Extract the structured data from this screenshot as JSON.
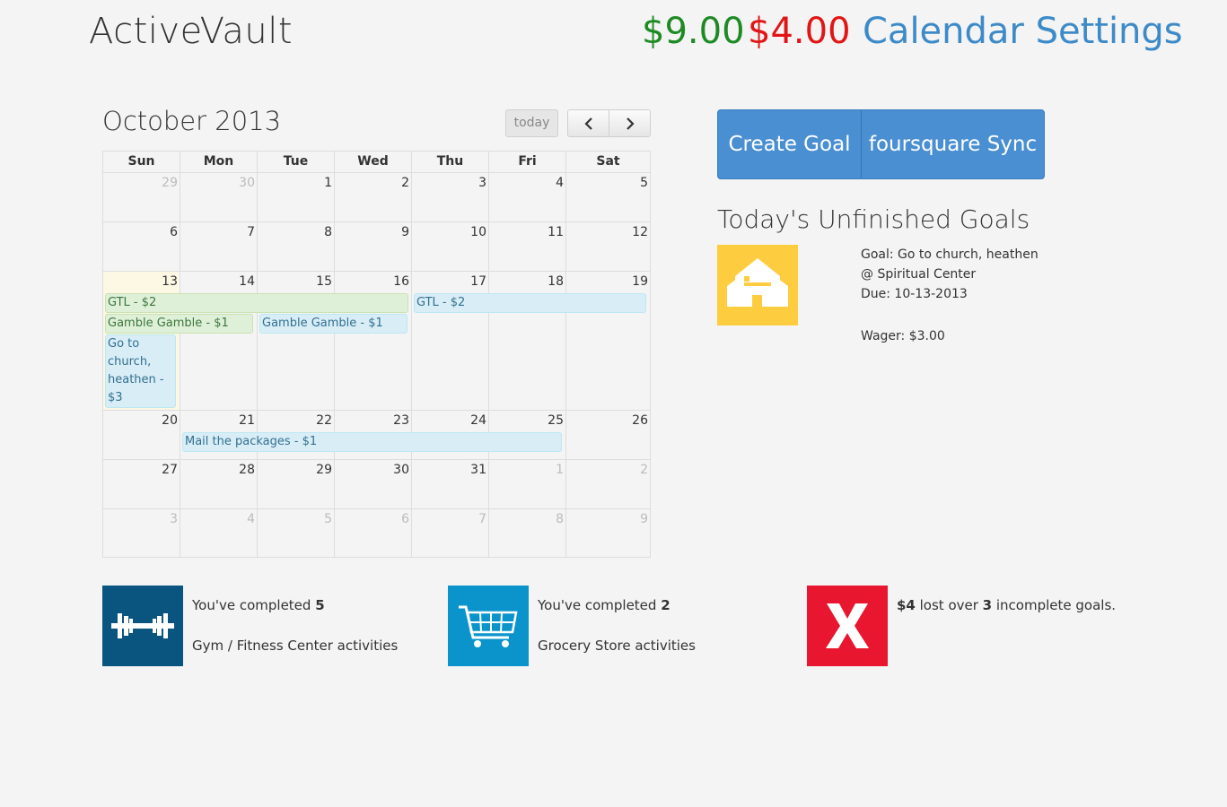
{
  "header": {
    "brand": "ActiveVault",
    "balance_won": "$9.00",
    "balance_lost": "$4.00",
    "settings_link": "Calendar Settings"
  },
  "calendar": {
    "title": "October 2013",
    "today_label": "today",
    "prev_icon": "chevron-left-icon",
    "next_icon": "chevron-right-icon",
    "weekdays": [
      "Sun",
      "Mon",
      "Tue",
      "Wed",
      "Thu",
      "Fri",
      "Sat"
    ],
    "weeks": [
      [
        "29",
        "30",
        "1",
        "2",
        "3",
        "4",
        "5"
      ],
      [
        "6",
        "7",
        "8",
        "9",
        "10",
        "11",
        "12"
      ],
      [
        "13",
        "14",
        "15",
        "16",
        "17",
        "18",
        "19"
      ],
      [
        "20",
        "21",
        "22",
        "23",
        "24",
        "25",
        "26"
      ],
      [
        "27",
        "28",
        "29",
        "30",
        "31",
        "1",
        "2"
      ],
      [
        "3",
        "4",
        "5",
        "6",
        "7",
        "8",
        "9"
      ]
    ],
    "events": {
      "gtl_1": "GTL - $2",
      "gamble_1": "Gamble Gamble - $1",
      "church": "Go to church, heathen - $3",
      "gamble_2": "Gamble Gamble - $1",
      "gtl_2": "GTL - $2",
      "mail": "Mail the packages - $1"
    },
    "colors": {
      "green_event": "#dff0d8",
      "blue_event": "#d9edf7",
      "today_bg": "#fcf8e3"
    }
  },
  "actions": {
    "create_goal": "Create Goal",
    "foursquare_sync": "foursquare Sync"
  },
  "unfinished_goals": {
    "heading": "Today's Unfinished Goals",
    "icon": "church-building-icon",
    "goal_line": "Goal: Go to church, heathen",
    "venue_line": "@ Spiritual Center",
    "due_line": "Due: 10-13-2013",
    "wager_line": "Wager: $3.00"
  },
  "stats": {
    "gym": {
      "icon": "barbell-icon",
      "prefix": "You've completed ",
      "count": "5",
      "category": "Gym / Fitness Center activities",
      "color": "#0a557f"
    },
    "grocery": {
      "icon": "shopping-cart-icon",
      "prefix": "You've completed ",
      "count": "2",
      "category": "Grocery Store activities",
      "color": "#0a94cb"
    },
    "lost": {
      "icon": "x-icon",
      "amount": "$4",
      "middle": " lost over ",
      "count": "3",
      "suffix": " incomplete goals.",
      "color": "#e8162f"
    }
  }
}
